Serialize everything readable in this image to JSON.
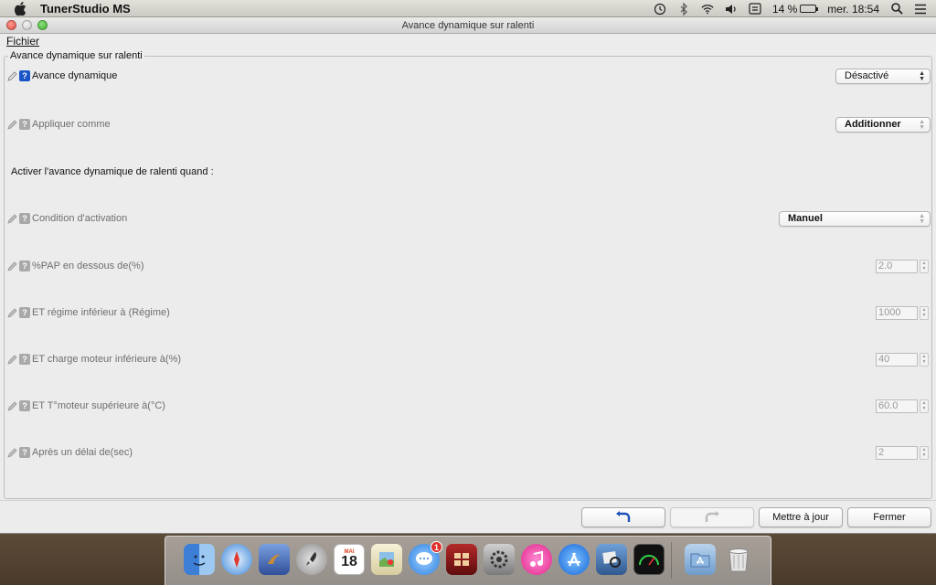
{
  "menubar": {
    "app_name": "TunerStudio MS",
    "battery_text": "14 %",
    "clock": "mer. 18:54",
    "battery_level": 0.14
  },
  "window": {
    "title": "Avance dynamique sur ralenti",
    "menu_file": "Fichier"
  },
  "panel": {
    "legend": "Avance dynamique sur ralenti",
    "section_heading": "Activer l'avance dynamique de ralenti quand :",
    "rows": {
      "avance_dynamique": {
        "label": "Avance dynamique",
        "value": "Désactivé"
      },
      "appliquer_comme": {
        "label": "Appliquer comme",
        "value": "Additionner"
      },
      "condition_activation": {
        "label": "Condition d'activation",
        "value": "Manuel"
      },
      "pap": {
        "label": "%PAP en dessous de(%)",
        "value": "2.0"
      },
      "regime": {
        "label": "ET régime inférieur à (Régime)",
        "value": "1000"
      },
      "charge": {
        "label": "ET charge moteur inférieure à(%)",
        "value": "40"
      },
      "temp": {
        "label": "ET T°moteur supérieure à(°C)",
        "value": "60.0"
      },
      "delai": {
        "label": "Après un délai de(sec)",
        "value": "2"
      }
    }
  },
  "buttons": {
    "undo_icon": "undo-arrow-icon",
    "redo_icon": "redo-arrow-icon",
    "update": "Mettre à jour",
    "close": "Fermer"
  },
  "dock": {
    "calendar_month": "MAI",
    "calendar_day": "18",
    "messages_badge": "1"
  },
  "colors": {
    "help_active": "#1a55c8",
    "help_dim": "#a9a9a9",
    "window_bg": "#ececec"
  }
}
